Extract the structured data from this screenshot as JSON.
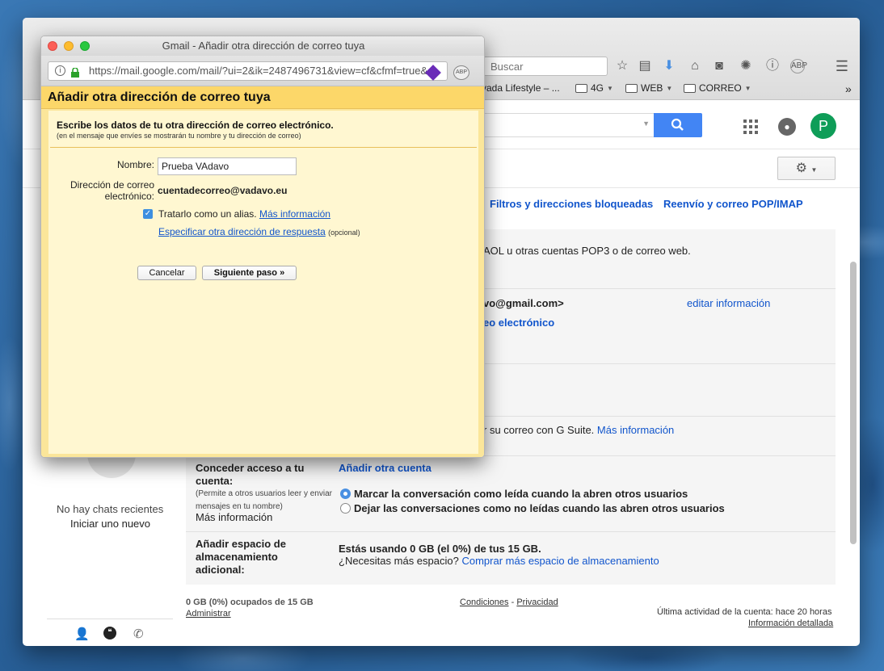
{
  "popup": {
    "window_title": "Gmail - Añadir otra dirección de correo tuya",
    "url": "https://mail.google.com/mail/?ui=2&ik=2487496731&view=cf&cfmf=true&",
    "header": "Añadir otra dirección de correo tuya",
    "intro_bold": "Escribe los datos de tu otra dirección de correo electrónico.",
    "intro_small": "(en el mensaje que envíes se mostrarán tu nombre y tu dirección de correo)",
    "name_label": "Nombre:",
    "name_value": "Prueba VAdavo",
    "email_label_1": "Dirección de correo",
    "email_label_2": "electrónico:",
    "email_value": "cuentadecorreo@vadavo.eu",
    "alias_label": "Tratarlo como un alias.",
    "alias_link": "Más información",
    "reply_link": "Especificar otra dirección de respuesta",
    "reply_optional": "(opcional)",
    "cancel_label": "Cancelar",
    "next_label": "Siguiente paso »"
  },
  "browser": {
    "search_placeholder": "Buscar",
    "bookmarks": [
      {
        "label": "vada Lifestyle – ..."
      },
      {
        "label": "4G"
      },
      {
        "label": "WEB"
      },
      {
        "label": "CORREO"
      }
    ],
    "overflow": "»"
  },
  "gmail": {
    "avatar_letter": "P",
    "tabs": {
      "filters": "Filtros y direcciones bloqueadas",
      "forwarding": "Reenvío y correo POP/IMAP"
    },
    "rows": {
      "import_text": "AOL u otras cuentas POP3 o de correo web.",
      "send_as_email": "vo@gmail.com>",
      "edit_info": "editar información",
      "add_email": "eo electrónico",
      "gsuite_text": "r su correo con G Suite.",
      "gsuite_link": "Más información",
      "grant_title": "Conceder acceso a tu cuenta:",
      "grant_small": "(Permite a otros usuarios leer y enviar mensajes en tu nombre)",
      "grant_more": "Más información",
      "add_account": "Añadir otra cuenta",
      "radio_1": "Marcar la conversación como leída cuando la abren otros usuarios",
      "radio_2": "Dejar las conversaciones como no leídas cuando las abren otros usuarios",
      "storage_title": "Añadir espacio de almacenamiento adicional:",
      "storage_usage": "Estás usando 0 GB (el 0%) de tus 15 GB.",
      "storage_question": "¿Necesitas más espacio?",
      "storage_link": "Comprar más espacio de almacenamiento"
    },
    "chat": {
      "no_chats": "No hay chats recientes",
      "start_new": "Iniciar uno nuevo"
    },
    "footer": {
      "usage": "0 GB (0%) ocupados de 15 GB",
      "manage": "Administrar",
      "terms": "Condiciones",
      "sep": " - ",
      "privacy": "Privacidad",
      "last_activity": "Última actividad de la cuenta: hace 20 horas",
      "details": "Información detallada"
    }
  }
}
